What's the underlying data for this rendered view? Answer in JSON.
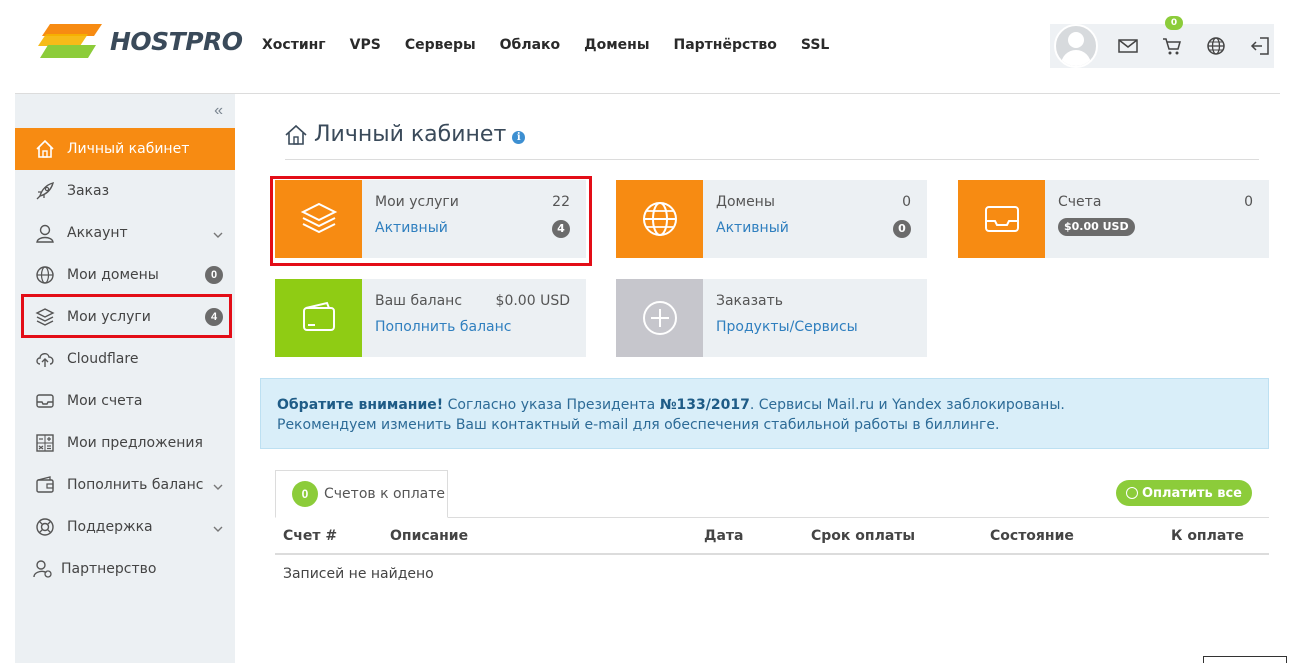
{
  "brand": {
    "name": "HOSTPRO"
  },
  "topnav": [
    "Хостинг",
    "VPS",
    "Серверы",
    "Облако",
    "Домены",
    "Партнёрство",
    "SSL"
  ],
  "userbar": {
    "cart_count": "0"
  },
  "sidebar": {
    "collapse_label": "«",
    "items": [
      {
        "label": "Личный кабинет",
        "icon": "home-icon",
        "active": true
      },
      {
        "label": "Заказ",
        "icon": "rocket-icon"
      },
      {
        "label": "Аккаунт",
        "icon": "user-icon",
        "chevron": true
      },
      {
        "label": "Мои домены",
        "icon": "globe-icon",
        "badge": "0"
      },
      {
        "label": "Мои услуги",
        "icon": "layers-icon",
        "badge": "4"
      },
      {
        "label": "Cloudflare",
        "icon": "cloud-upload-icon"
      },
      {
        "label": "Мои счета",
        "icon": "inbox-icon"
      },
      {
        "label": "Мои предложения",
        "icon": "calculator-icon"
      },
      {
        "label": "Пополнить баланс",
        "icon": "wallet-icon",
        "chevron": true
      },
      {
        "label": "Поддержка",
        "icon": "lifebuoy-icon",
        "chevron": true
      },
      {
        "label": "Партнерство",
        "icon": "partner-icon"
      }
    ]
  },
  "page": {
    "title": "Личный кабинет",
    "info": "i"
  },
  "tiles": {
    "services": {
      "title": "Мои услуги",
      "count": "22",
      "link": "Активный",
      "badge": "4"
    },
    "domains": {
      "title": "Домены",
      "count": "0",
      "link": "Активный",
      "badge": "0"
    },
    "invoices": {
      "title": "Счета",
      "count": "0",
      "amount": "$0.00 USD"
    },
    "balance": {
      "title": "Ваш баланс",
      "amount": "$0.00 USD",
      "link": "Пополнить баланс"
    },
    "order": {
      "title": "Заказать",
      "link": "Продукты/Сервисы"
    }
  },
  "alert": {
    "bold": "Обратите внимание!",
    "line1": " Согласно указа Президента ",
    "decree": "№133/2017",
    "line1_end": ". Сервисы Mail.ru и Yandex заблокированы.",
    "line2": "Рекомендуем изменить Ваш контактный e-mail для обеспечения стабильной работы в биллинге."
  },
  "invoices_tab": {
    "count": "0",
    "label": "Счетов к оплате",
    "pay_all": "Оплатить все"
  },
  "table": {
    "columns": [
      "Счет #",
      "Описание",
      "Дата",
      "Срок оплаты",
      "Состояние",
      "К оплате"
    ],
    "empty": "Записей не найдено"
  },
  "colors": {
    "accent": "#f78b12",
    "green": "#8ccc3a",
    "link": "#2f7fbf",
    "highlight": "#e30d17"
  }
}
